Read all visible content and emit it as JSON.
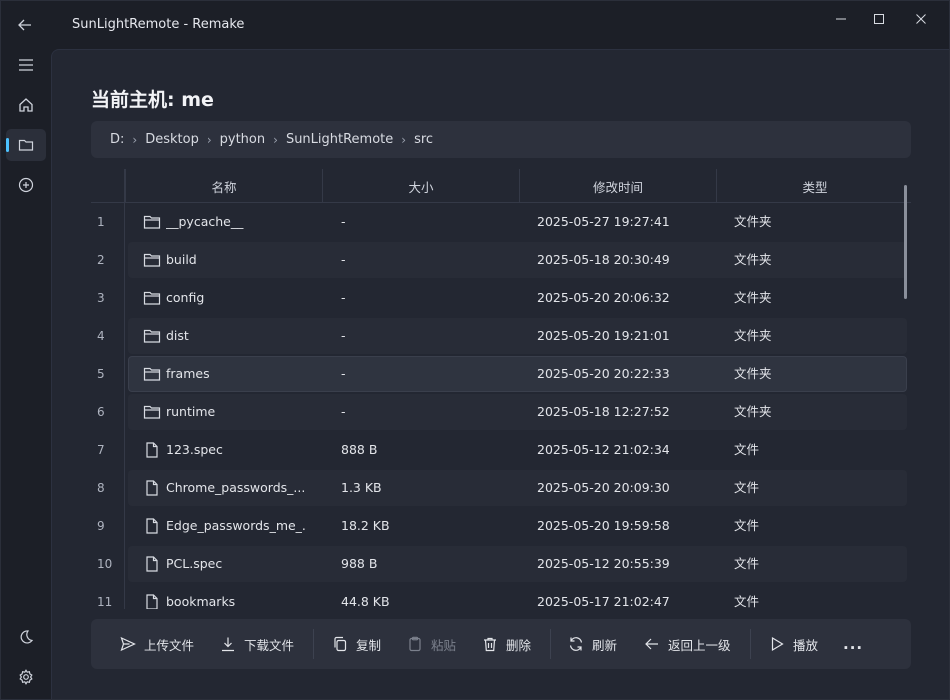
{
  "titlebar": {
    "title": "SunLightRemote - Remake"
  },
  "nav": {
    "items": [
      "menu-icon",
      "home-icon",
      "folder-icon",
      "add-circle-icon"
    ],
    "bottom": [
      "theme-moon-icon",
      "settings-gear-icon"
    ],
    "accent": "#4cc2ff"
  },
  "main": {
    "host_title": "当前主机: me",
    "breadcrumb": [
      "D:",
      "Desktop",
      "python",
      "SunLightRemote",
      "src"
    ],
    "columns": [
      "名称",
      "大小",
      "修改时间",
      "类型"
    ],
    "rows": [
      {
        "num": "1",
        "icon": "folder",
        "name": "__pycache__",
        "size": "-",
        "modified": "2025-05-27 19:27:41",
        "type": "文件夹"
      },
      {
        "num": "2",
        "icon": "folder",
        "name": "build",
        "size": "-",
        "modified": "2025-05-18 20:30:49",
        "type": "文件夹"
      },
      {
        "num": "3",
        "icon": "folder",
        "name": "config",
        "size": "-",
        "modified": "2025-05-20 20:06:32",
        "type": "文件夹"
      },
      {
        "num": "4",
        "icon": "folder",
        "name": "dist",
        "size": "-",
        "modified": "2025-05-20 19:21:01",
        "type": "文件夹"
      },
      {
        "num": "5",
        "icon": "folder",
        "name": "frames",
        "size": "-",
        "modified": "2025-05-20 20:22:33",
        "type": "文件夹"
      },
      {
        "num": "6",
        "icon": "folder",
        "name": "runtime",
        "size": "-",
        "modified": "2025-05-18 12:27:52",
        "type": "文件夹"
      },
      {
        "num": "7",
        "icon": "file",
        "name": "123.spec",
        "size": "888 B",
        "modified": "2025-05-12 21:02:34",
        "type": "文件"
      },
      {
        "num": "8",
        "icon": "file",
        "name": "Chrome_passwords_...",
        "size": "1.3 KB",
        "modified": "2025-05-20 20:09:30",
        "type": "文件"
      },
      {
        "num": "9",
        "icon": "file",
        "name": "Edge_passwords_me_...",
        "size": "18.2 KB",
        "modified": "2025-05-20 19:59:58",
        "type": "文件"
      },
      {
        "num": "10",
        "icon": "file",
        "name": "PCL.spec",
        "size": "988 B",
        "modified": "2025-05-12 20:55:39",
        "type": "文件"
      },
      {
        "num": "11",
        "icon": "file",
        "name": "bookmarks",
        "size": "44.8 KB",
        "modified": "2025-05-17 21:02:47",
        "type": "文件"
      }
    ]
  },
  "toolbar": {
    "upload": "上传文件",
    "download": "下载文件",
    "copy": "复制",
    "paste": "粘贴",
    "delete": "删除",
    "refresh": "刷新",
    "go_up": "返回上一级",
    "play": "播放",
    "more": "..."
  }
}
